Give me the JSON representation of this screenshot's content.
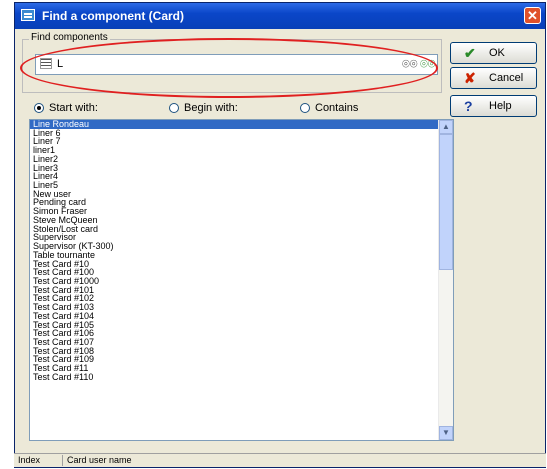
{
  "window": {
    "title": "Find a component (Card)"
  },
  "group": {
    "label": "Find components"
  },
  "search": {
    "value": "L"
  },
  "buttons": {
    "ok": "OK",
    "cancel": "Cancel",
    "help": "Help"
  },
  "radios": [
    {
      "label": "Start with:",
      "selected": true
    },
    {
      "label": "Begin with:",
      "selected": false
    },
    {
      "label": "Contains",
      "selected": false
    }
  ],
  "list": {
    "selected_index": 0,
    "items": [
      "Line Rondeau",
      "Liner 6",
      "Liner 7",
      "liner1",
      "Liner2",
      "Liner3",
      "Liner4",
      "Liner5",
      "New user",
      "Pending card",
      "Simon Fraser",
      "Steve McQueen",
      "Stolen/Lost card",
      "Supervisor",
      "Supervisor (KT-300)",
      "Table tournante",
      "Test Card #10",
      "Test Card #100",
      "Test Card #1000",
      "Test Card #101",
      "Test Card #102",
      "Test Card #103",
      "Test Card #104",
      "Test Card #105",
      "Test Card #106",
      "Test Card #107",
      "Test Card #108",
      "Test Card #109",
      "Test Card #11",
      "Test Card #110"
    ]
  },
  "status": {
    "col1": "Index",
    "col2": "Card user name"
  },
  "icons": {
    "app": "app-window-icon",
    "close": "close-icon",
    "ok": "check-icon",
    "cancel": "x-icon",
    "help": "question-icon",
    "find": "binoculars-icon"
  },
  "colors": {
    "title_bar": "#0a46c8",
    "selection": "#316ac5",
    "highlight_ellipse": "#e02020",
    "ok_check": "#2a8a2a",
    "cancel_x": "#cc2200",
    "help_q": "#1a3fa0"
  }
}
